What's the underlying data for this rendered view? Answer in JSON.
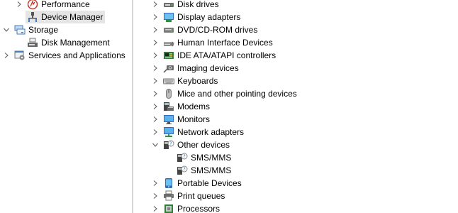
{
  "left_tree": {
    "performance": {
      "label": "Performance",
      "icon": "performance-icon"
    },
    "device_manager": {
      "label": "Device Manager",
      "icon": "device-manager-icon"
    },
    "storage": {
      "label": "Storage",
      "icon": "storage-icon"
    },
    "disk_management": {
      "label": "Disk Management",
      "icon": "disk-management-icon"
    },
    "services": {
      "label": "Services and Applications",
      "icon": "services-icon"
    }
  },
  "device_tree": {
    "items": [
      {
        "label": "Disk drives",
        "icon": "disk-drive-icon"
      },
      {
        "label": "Display adapters",
        "icon": "display-adapter-icon"
      },
      {
        "label": "DVD/CD-ROM drives",
        "icon": "dvd-drive-icon"
      },
      {
        "label": "Human Interface Devices",
        "icon": "hid-icon"
      },
      {
        "label": "IDE ATA/ATAPI controllers",
        "icon": "ide-controller-icon"
      },
      {
        "label": "Imaging devices",
        "icon": "camera-icon"
      },
      {
        "label": "Keyboards",
        "icon": "keyboard-icon"
      },
      {
        "label": "Mice and other pointing devices",
        "icon": "mouse-icon"
      },
      {
        "label": "Modems",
        "icon": "modem-icon"
      },
      {
        "label": "Monitors",
        "icon": "monitor-icon"
      },
      {
        "label": "Network adapters",
        "icon": "network-adapter-icon"
      },
      {
        "label": "Other devices",
        "icon": "unknown-device-icon"
      },
      {
        "label": "SMS/MMS",
        "icon": "unknown-device-icon"
      },
      {
        "label": "SMS/MMS",
        "icon": "unknown-device-icon"
      },
      {
        "label": "Portable Devices",
        "icon": "portable-device-icon"
      },
      {
        "label": "Print queues",
        "icon": "printer-icon"
      },
      {
        "label": "Processors",
        "icon": "processor-icon"
      }
    ]
  },
  "colors": {
    "selected_bg": "#e5e5e5",
    "chevron": "#5f5f5f",
    "divider": "#d7d7d7"
  }
}
